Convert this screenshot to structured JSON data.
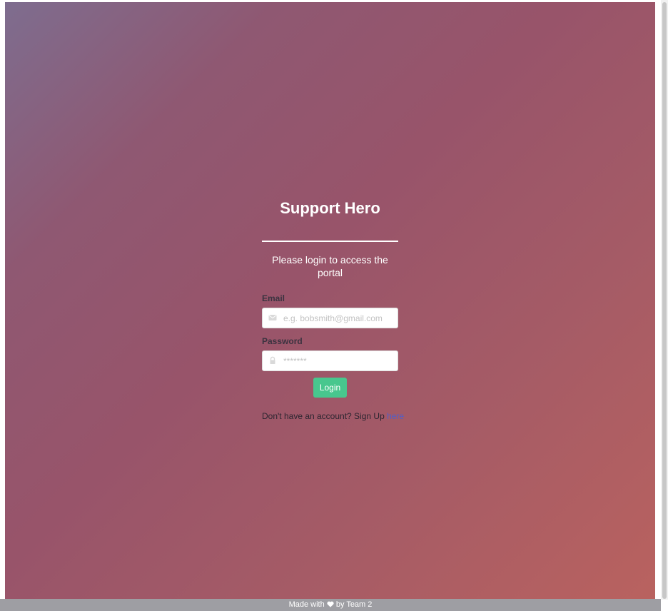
{
  "app": {
    "title": "Support Hero",
    "subtitle": "Please login to access the portal"
  },
  "form": {
    "email": {
      "label": "Email",
      "placeholder": "e.g. bobsmith@gmail.com",
      "value": "",
      "icon": "envelope-icon"
    },
    "password": {
      "label": "Password",
      "placeholder": "*******",
      "value": "",
      "icon": "lock-icon"
    },
    "submit_label": "Login"
  },
  "signup": {
    "prompt": "Don't have an account? Sign Up ",
    "link_text": "here"
  },
  "footer": {
    "prefix": "Made with",
    "icon": "heart-icon",
    "suffix": "by Team 2"
  },
  "colors": {
    "gradient_start": "#7e6d8f",
    "gradient_end": "#b9625f",
    "button": "#48c78e",
    "link": "#4f5fc9",
    "footer_bg": "#9e9ea3"
  }
}
